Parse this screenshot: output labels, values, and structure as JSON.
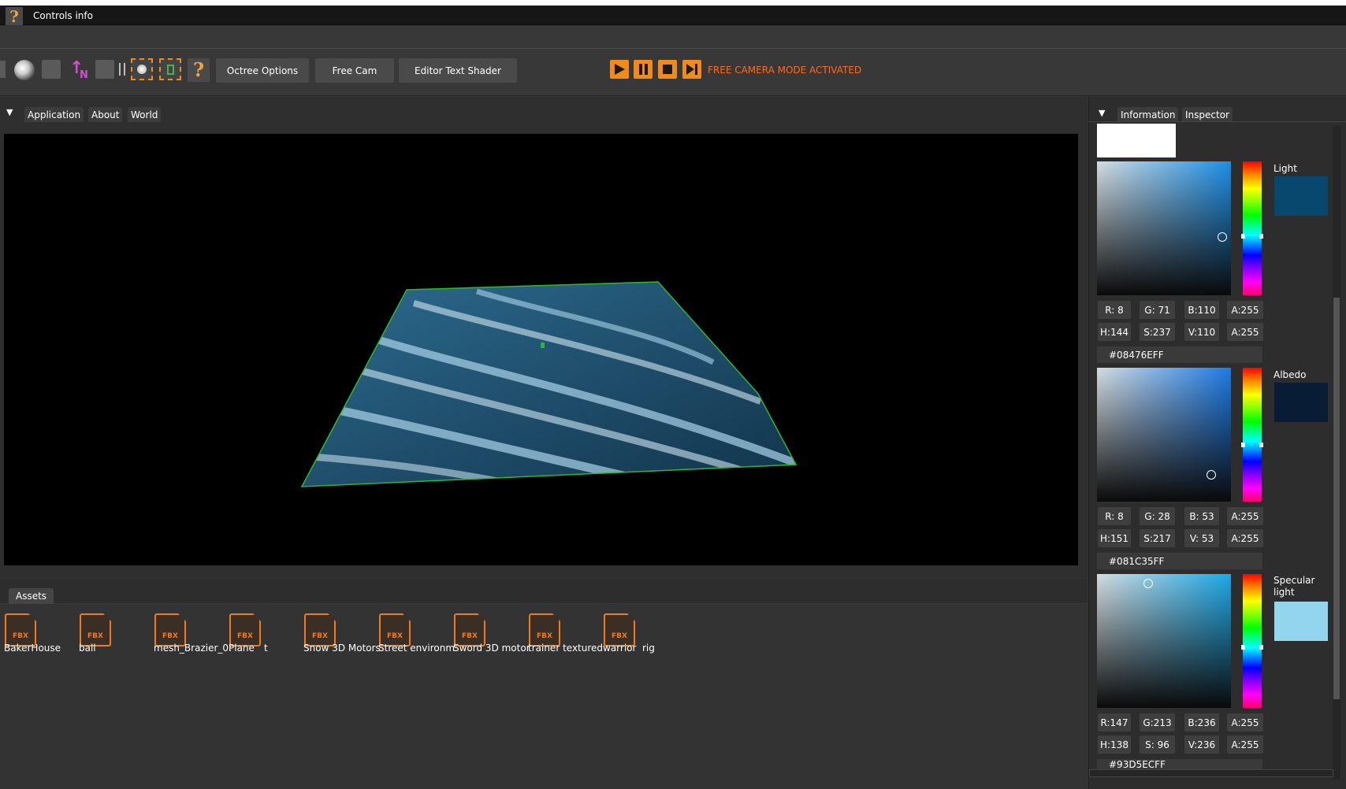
{
  "menubar": {
    "title": "Controls info",
    "help_icon": "question-mark-icon"
  },
  "toolbar": {
    "octree_label": "Octree Options",
    "freecam_label": "Free Cam",
    "shader_label": "Editor Text Shader",
    "status": "FREE CAMERA MODE ACTIVATED",
    "normal_icon_label": "N",
    "accent": "#f28a17"
  },
  "left_tabs": [
    "Application",
    "About",
    "World"
  ],
  "assets": {
    "tab_label": "Assets",
    "badge": "FBX",
    "items": [
      "BakerHouse",
      "ball",
      "mesh_Brazier_0:",
      "Plane",
      "t",
      "Snow 3D Motors",
      "Street environm",
      "Sword 3D motor",
      "trainer textured",
      "warrior",
      "rig"
    ]
  },
  "right_tabs": [
    "Information",
    "Inspector"
  ],
  "pickers": [
    {
      "label": "Light",
      "swatch": "#08476E",
      "r": "R:  8",
      "g": "G: 71",
      "b": "B:110",
      "a1": "A:255",
      "h": "H:144",
      "s": "S:237",
      "v": "V:110",
      "a2": "A:255",
      "hex": "#08476EFF"
    },
    {
      "label": "Albedo",
      "swatch": "#081C35",
      "r": "R:  8",
      "g": "G: 28",
      "b": "B: 53",
      "a1": "A:255",
      "h": "H:151",
      "s": "S:217",
      "v": "V: 53",
      "a2": "A:255",
      "hex": "#081C35FF"
    },
    {
      "label": "Specular light",
      "swatch": "#93D5EC",
      "r": "R:147",
      "g": "G:213",
      "b": "B:236",
      "a1": "A:255",
      "h": "H:138",
      "s": "S: 96",
      "v": "V:236",
      "a2": "A:255",
      "hex": "#93D5ECFF"
    }
  ]
}
